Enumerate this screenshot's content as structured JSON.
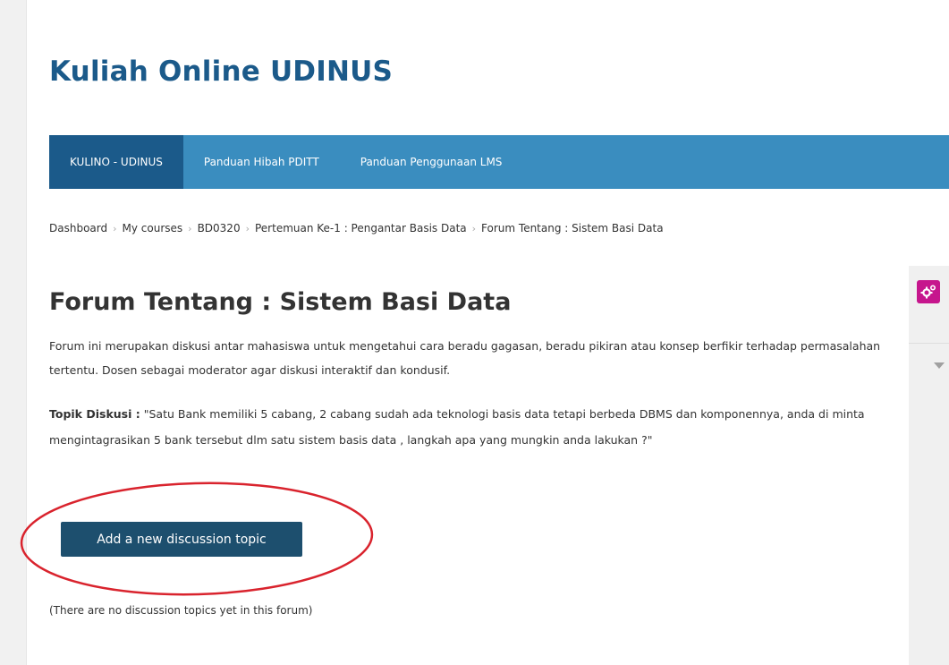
{
  "site": {
    "title": "Kuliah Online UDINUS"
  },
  "nav": {
    "items": [
      {
        "label": "KULINO - UDINUS",
        "active": true
      },
      {
        "label": "Panduan Hibah PDITT",
        "active": false
      },
      {
        "label": "Panduan Penggunaan LMS",
        "active": false
      }
    ]
  },
  "breadcrumb": {
    "items": [
      "Dashboard",
      "My courses",
      "BD0320",
      "Pertemuan Ke-1 : Pengantar Basis Data",
      "Forum Tentang : Sistem Basi Data"
    ],
    "separator": "›"
  },
  "forum": {
    "title": "Forum Tentang : Sistem Basi Data",
    "intro": "Forum ini merupakan diskusi antar mahasiswa untuk mengetahui cara beradu gagasan, beradu pikiran atau konsep berfikir terhadap permasalahan tertentu. Dosen sebagai moderator agar diskusi interaktif dan kondusif.",
    "topic_label": "Topik Diskusi :",
    "topic_text": " \"Satu Bank memiliki 5 cabang, 2 cabang sudah ada teknologi basis data tetapi berbeda DBMS dan komponennya, anda di minta mengintagrasikan 5 bank tersebut dlm satu sistem basis data , langkah apa yang mungkin anda lakukan ?\"",
    "add_button_label": "Add a new discussion topic",
    "empty_message": "(There are no discussion topics yet in this forum)"
  },
  "side_panel": {
    "settings_icon": "gears-icon",
    "toggle_icon": "caret-down-icon"
  },
  "colors": {
    "brand": "#1b5a8a",
    "nav_bg": "#3a8dbf",
    "button_bg": "#1d4f6e",
    "highlight_ellipse": "#d9232d",
    "settings_badge": "#c6168d"
  }
}
